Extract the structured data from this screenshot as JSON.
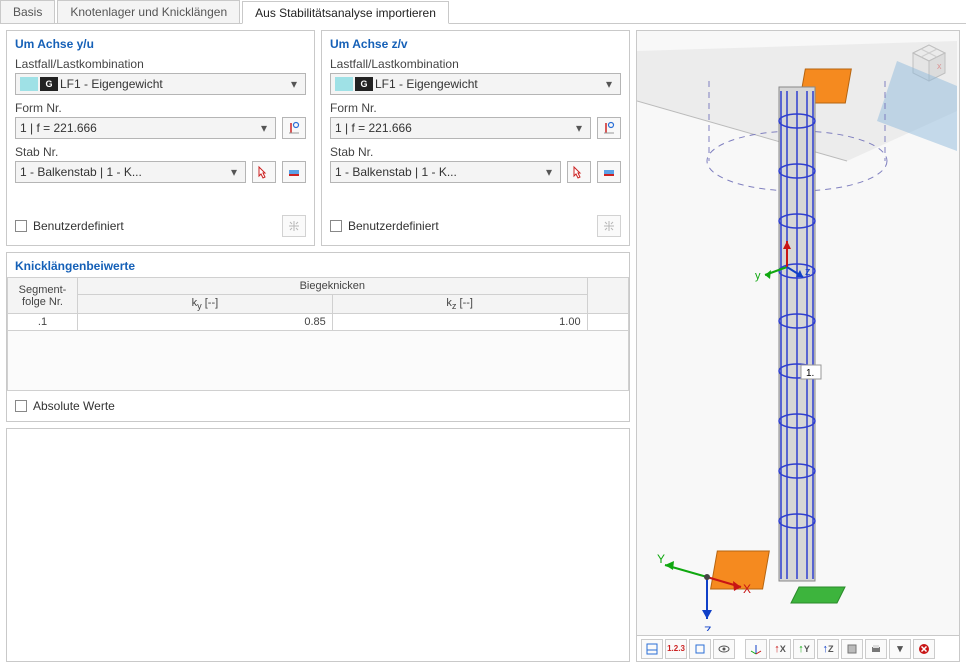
{
  "tabs": {
    "t0": "Basis",
    "t1": "Knotenlager und Knicklängen",
    "t2": "Aus Stabilitätsanalyse importieren"
  },
  "panels": {
    "yu": {
      "title": "Um Achse y/u",
      "loadcase_label": "Lastfall/Lastkombination",
      "loadcase_badge": "G",
      "loadcase_value": "LF1 - Eigengewicht",
      "form_label": "Form Nr.",
      "form_value": "1 | f = 221.666",
      "member_label": "Stab Nr.",
      "member_value": "1 - Balkenstab | 1 - K...",
      "userdef_label": "Benutzerdefiniert"
    },
    "zv": {
      "title": "Um Achse z/v",
      "loadcase_label": "Lastfall/Lastkombination",
      "loadcase_badge": "G",
      "loadcase_value": "LF1 - Eigengewicht",
      "form_label": "Form Nr.",
      "form_value": "1 | f = 221.666",
      "member_label": "Stab Nr.",
      "member_value": "1 - Balkenstab | 1 - K...",
      "userdef_label": "Benutzerdefiniert"
    }
  },
  "coefs": {
    "title": "Knicklängenbeiwerte",
    "col_seg1": "Segment-",
    "col_seg2": "folge Nr.",
    "col_bk_group": "Biegeknicken",
    "col_ky": "k",
    "col_ky_sub": "y",
    "col_unit": " [--]",
    "col_kz": "k",
    "col_kz_sub": "z",
    "row_seg": ".1",
    "row_ky": "0.85",
    "row_kz": "1.00",
    "abs_label": "Absolute Werte"
  },
  "view": {
    "axis_x": "X",
    "axis_y": "Y",
    "axis_z": "Z",
    "label_1": "1.",
    "cube_x": "x"
  },
  "toolbar3d": {
    "b3": "1.2.3",
    "bx": "X",
    "by": "Y",
    "bz": "Z"
  }
}
